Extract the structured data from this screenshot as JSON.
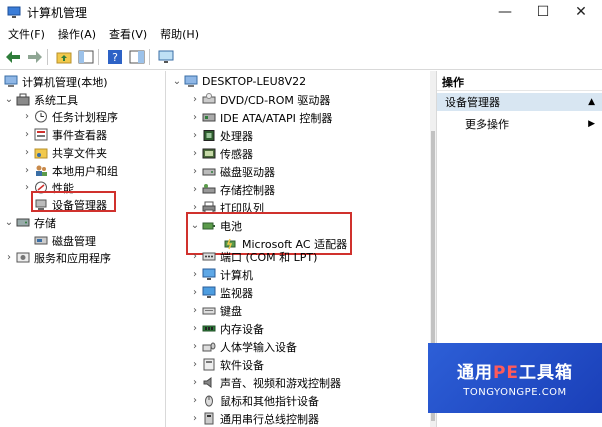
{
  "window": {
    "title": "计算机管理",
    "minimize": "—",
    "maximize": "☐",
    "close": "✕"
  },
  "menu": [
    "文件(F)",
    "操作(A)",
    "查看(V)",
    "帮助(H)"
  ],
  "left_tree": {
    "root": "计算机管理(本地)",
    "system_tools": "系统工具",
    "task_scheduler": "任务计划程序",
    "event_viewer": "事件查看器",
    "shared_folders": "共享文件夹",
    "local_users": "本地用户和组",
    "performance": "性能",
    "device_manager": "设备管理器",
    "storage": "存储",
    "disk_management": "磁盘管理",
    "services_apps": "服务和应用程序"
  },
  "device_tree": {
    "computer": "DESKTOP-LEU8V22",
    "dvd": "DVD/CD-ROM 驱动器",
    "ide": "IDE ATA/ATAPI 控制器",
    "processor": "处理器",
    "sensors": "传感器",
    "disk_drives": "磁盘驱动器",
    "storage_ctrl": "存储控制器",
    "print_queue": "打印队列",
    "battery": "电池",
    "ac_adapter": "Microsoft AC 适配器",
    "ports": "端口 (COM 和 LPT)",
    "computer_node": "计算机",
    "monitors": "监视器",
    "keyboards": "键盘",
    "memory": "内存设备",
    "hid": "人体学输入设备",
    "software_devices": "软件设备",
    "audio": "声音、视频和游戏控制器",
    "mice": "鼠标和其他指针设备",
    "usb": "通用串行总线控制器"
  },
  "actions": {
    "header": "操作",
    "selected": "设备管理器",
    "more": "更多操作"
  },
  "watermark": {
    "title_a": "通用",
    "title_pe": "PE",
    "title_b": "工具箱",
    "subtitle": "TONGYONGPE.COM"
  }
}
